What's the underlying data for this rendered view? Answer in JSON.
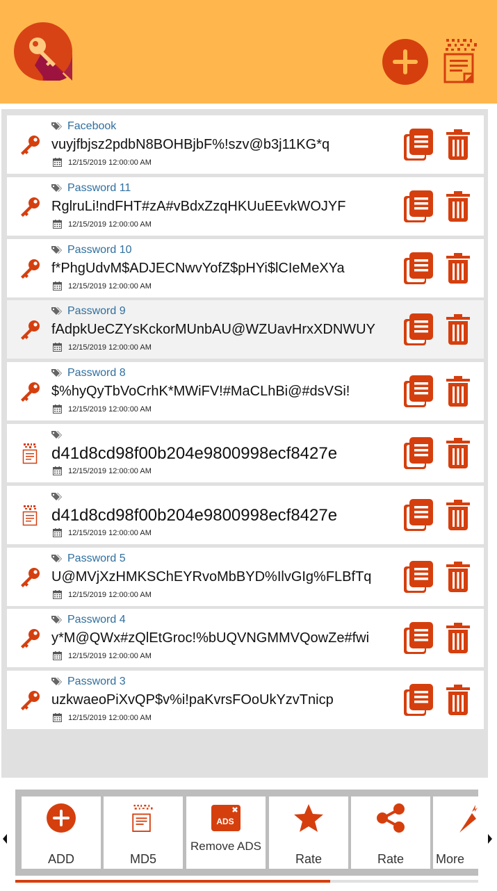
{
  "colors": {
    "header": "#ffb74d",
    "accent": "#d53f0e",
    "title_blue": "#2f6f9f"
  },
  "header": {
    "logo_icon": "key-logo-icon",
    "add_icon": "plus-circle-icon",
    "md5_icon": "md5-document-icon"
  },
  "entries": [
    {
      "type": "password",
      "title": "Facebook",
      "value": "vuyjfbjsz2pdbN8BOHBjbF%!szv@b3j11KG*q",
      "date": "12/15/2019 12:00:00 AM"
    },
    {
      "type": "password",
      "title": "Password 11",
      "value": "RglruLi!ndFHT#zA#vBdxZzqHKUuEEvkWOJYF",
      "date": "12/15/2019 12:00:00 AM"
    },
    {
      "type": "password",
      "title": "Password 10",
      "value": "f*PhgUdvM$ADJECNwvYofZ$pHYi$lCIeMeXYa",
      "date": "12/15/2019 12:00:00 AM"
    },
    {
      "type": "password",
      "title": "Password 9",
      "value": "fAdpkUeCZYsKckorMUnbAU@WZUavHrxXDNWUY",
      "date": "12/15/2019 12:00:00 AM"
    },
    {
      "type": "password",
      "title": "Password 8",
      "value": "$%hyQyTbVoCrhK*MWiFV!#MaCLhBi@#dsVSi!",
      "date": "12/15/2019 12:00:00 AM"
    },
    {
      "type": "md5",
      "title": "",
      "value": "d41d8cd98f00b204e9800998ecf8427e",
      "date": "12/15/2019 12:00:00 AM"
    },
    {
      "type": "md5",
      "title": "",
      "value": "d41d8cd98f00b204e9800998ecf8427e",
      "date": "12/15/2019 12:00:00 AM"
    },
    {
      "type": "password",
      "title": "Password 5",
      "value": "U@MVjXzHMKSChEYRvoMbBYD%IlvGIg%FLBfTq",
      "date": "12/15/2019 12:00:00 AM"
    },
    {
      "type": "password",
      "title": "Password 4",
      "value": "y*M@QWx#zQlEtGroc!%bUQVNGMMVQowZe#fwi",
      "date": "12/15/2019 12:00:00 AM"
    },
    {
      "type": "password",
      "title": "Password 3",
      "value": "uzkwaeoPiXvQP$v%i!paKvrsFOoUkYzvTnicp",
      "date": "12/15/2019 12:00:00 AM"
    }
  ],
  "bottom_menu": [
    {
      "label": "ADD",
      "icon": "plus-circle-icon"
    },
    {
      "label": "MD5",
      "icon": "md5-document-icon"
    },
    {
      "label": "Remove ADS",
      "icon": "ads-icon"
    },
    {
      "label": "Rate",
      "icon": "star-icon"
    },
    {
      "label": "Rate",
      "icon": "share-icon"
    },
    {
      "label": "More",
      "icon": "carrot-icon"
    }
  ],
  "scroll_progress": 0.68
}
